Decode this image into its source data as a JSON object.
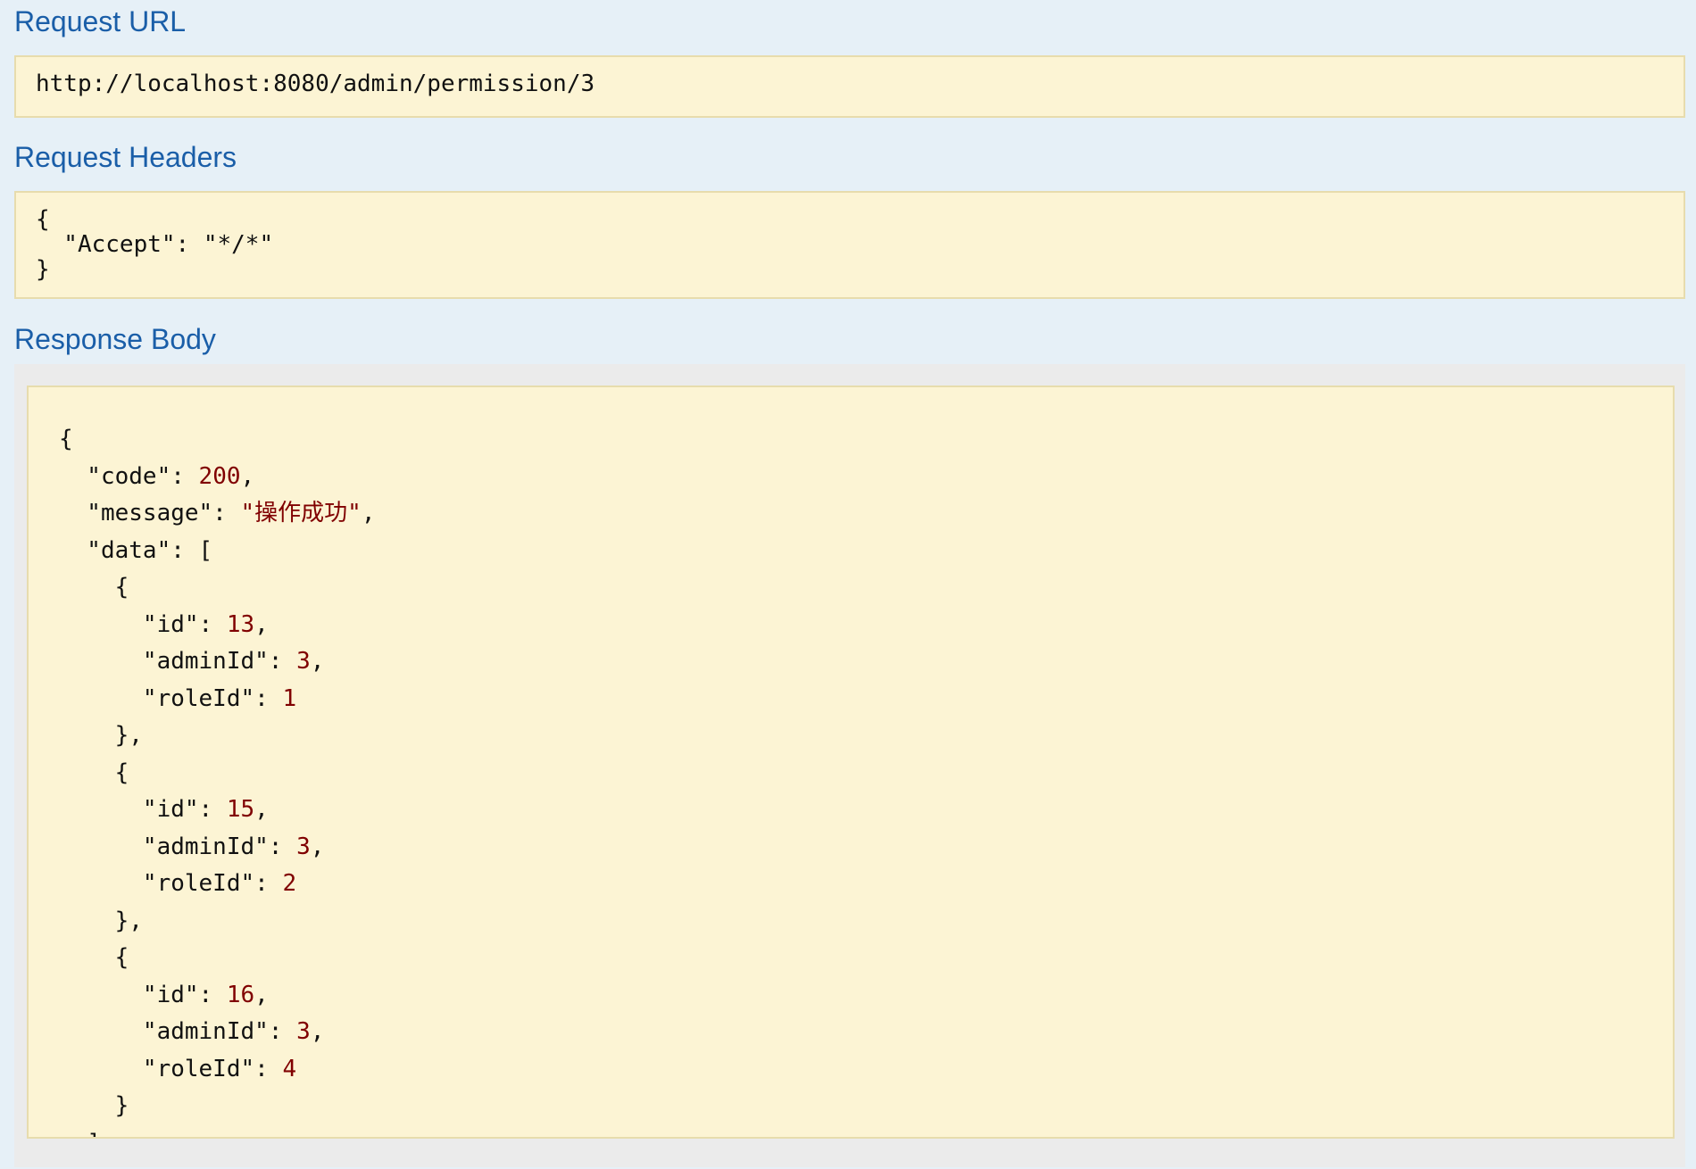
{
  "sections": {
    "request_url": {
      "heading": "Request URL",
      "value": "http://localhost:8080/admin/permission/3"
    },
    "request_headers": {
      "heading": "Request Headers",
      "lines": [
        "{",
        "  \"Accept\": \"*/*\"",
        "}"
      ]
    },
    "response_body": {
      "heading": "Response Body",
      "code": 200,
      "message": "操作成功",
      "data": [
        {
          "id": 13,
          "adminId": 3,
          "roleId": 1
        },
        {
          "id": 15,
          "adminId": 3,
          "roleId": 2
        },
        {
          "id": 16,
          "adminId": 3,
          "roleId": 4
        }
      ],
      "trailing_line": "  ]"
    }
  },
  "colors": {
    "page_background": "#e6f0f7",
    "heading": "#1a5ea8",
    "code_background": "#fcf4d4",
    "code_border": "#e7dcad",
    "value_literal": "#800000"
  }
}
